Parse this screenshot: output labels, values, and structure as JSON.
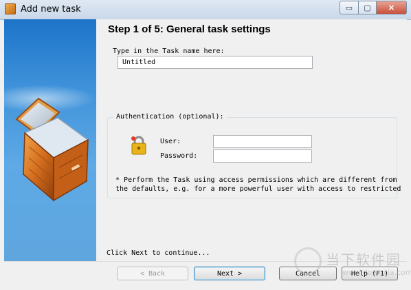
{
  "window": {
    "title": "Add new task",
    "minimize_glyph": "▭",
    "maximize_glyph": "▢",
    "close_glyph": "✕"
  },
  "step": {
    "title": "Step 1 of 5: General task settings"
  },
  "task_name": {
    "label": "Type in the Task name here:",
    "value": "Untitled"
  },
  "authentication": {
    "group_label": "Authentication (optional):",
    "user_label": "User:",
    "user_value": "",
    "password_label": "Password:",
    "password_value": "",
    "note_line1": "* Perform the Task using access permissions which are different from",
    "note_line2": "the defaults, e.g. for a more powerful user with access to restricted"
  },
  "instruction": "Click Next to continue...",
  "buttons": {
    "back": "< Back",
    "next": "Next >",
    "cancel": "Cancel",
    "help": "Help (F1)"
  },
  "watermark": {
    "text": "当下软件园",
    "url": "www.downxia.com"
  },
  "icons": {
    "app": "box-icon",
    "wizard_art": "open-box-icon",
    "lock": "lock-icon"
  }
}
